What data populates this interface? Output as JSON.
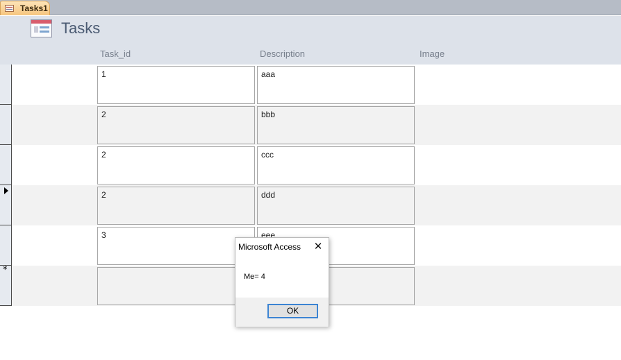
{
  "tab": {
    "label": "Tasks1",
    "icon": "form-icon"
  },
  "form": {
    "title": "Tasks",
    "icon": "form-icon"
  },
  "columns": [
    "Task_id",
    "Description",
    "Image"
  ],
  "rows": [
    {
      "task_id": "1",
      "description": "aaa"
    },
    {
      "task_id": "2",
      "description": "bbb"
    },
    {
      "task_id": "2",
      "description": "ccc"
    },
    {
      "task_id": "2",
      "description": "ddd",
      "current": true
    },
    {
      "task_id": "3",
      "description": "eee"
    },
    {
      "task_id": "",
      "description": "",
      "new": true
    }
  ],
  "record_selector_icons": {
    "current": "current-record-arrow-icon",
    "new": "new-record-star-icon"
  },
  "new_record_symbol": "*",
  "dialog": {
    "title": "Microsoft Access",
    "close_symbol": "✕",
    "message": "Me= 4",
    "ok_label": "OK"
  },
  "colors": {
    "tab_active": "#f6c57e",
    "header_bg": "#dde2ea",
    "alt_row": "#f2f2f2",
    "button_focus": "#3c84d3"
  }
}
